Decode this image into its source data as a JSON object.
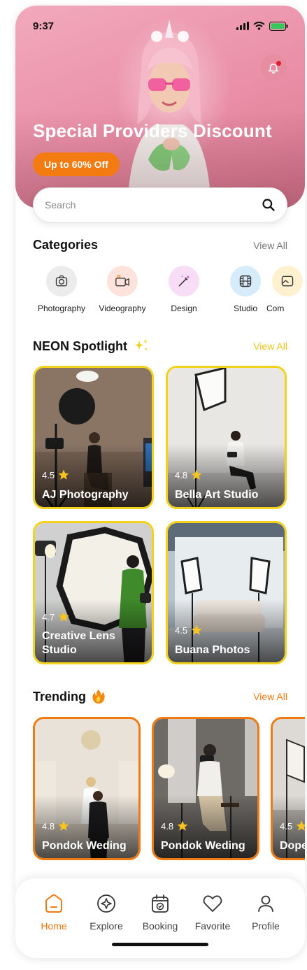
{
  "status": {
    "time": "9:37"
  },
  "hero": {
    "title": "Special Providers Discount",
    "promo": "Up to 60% Off"
  },
  "search": {
    "placeholder": "Search"
  },
  "categories": {
    "title": "Categories",
    "view_all": "View All",
    "items": [
      {
        "label": "Photography",
        "icon": "camera-icon",
        "bg": "#ececec",
        "color": "#333333"
      },
      {
        "label": "Videography",
        "icon": "video-camera-icon",
        "bg": "#fde3dc",
        "color": "#333333"
      },
      {
        "label": "Design",
        "icon": "magic-wand-icon",
        "bg": "#f7ddf5",
        "color": "#333333"
      },
      {
        "label": "Studio",
        "icon": "film-icon",
        "bg": "#d7ecfb",
        "color": "#333333"
      },
      {
        "label": "Com",
        "icon": "image-icon",
        "bg": "#fdf1cf",
        "color": "#333333"
      }
    ]
  },
  "spotlight": {
    "title": "NEON Spotlight",
    "view_all": "View All",
    "items": [
      {
        "rating": "4.5",
        "name": "AJ Photography"
      },
      {
        "rating": "4.8",
        "name": "Bella Art Studio"
      },
      {
        "rating": "4.7",
        "name": "Creative Lens Studio"
      },
      {
        "rating": "4.5",
        "name": "Buana Photos"
      }
    ]
  },
  "trending": {
    "title": "Trending",
    "view_all": "View All",
    "items": [
      {
        "rating": "4.8",
        "name": "Pondok Weding"
      },
      {
        "rating": "4.8",
        "name": "Pondok Weding"
      },
      {
        "rating": "4.5",
        "name": "Dope"
      }
    ]
  },
  "nav": {
    "items": [
      {
        "label": "Home",
        "icon": "home-icon",
        "active": true
      },
      {
        "label": "Explore",
        "icon": "compass-icon",
        "active": false
      },
      {
        "label": "Booking",
        "icon": "calendar-icon",
        "active": false
      },
      {
        "label": "Favorite",
        "icon": "heart-icon",
        "active": false
      },
      {
        "label": "Profile",
        "icon": "user-icon",
        "active": false
      }
    ]
  },
  "colors": {
    "accent": "#f07a12",
    "spotlight_border": "#f2d21c",
    "star": "#f7c51e"
  }
}
